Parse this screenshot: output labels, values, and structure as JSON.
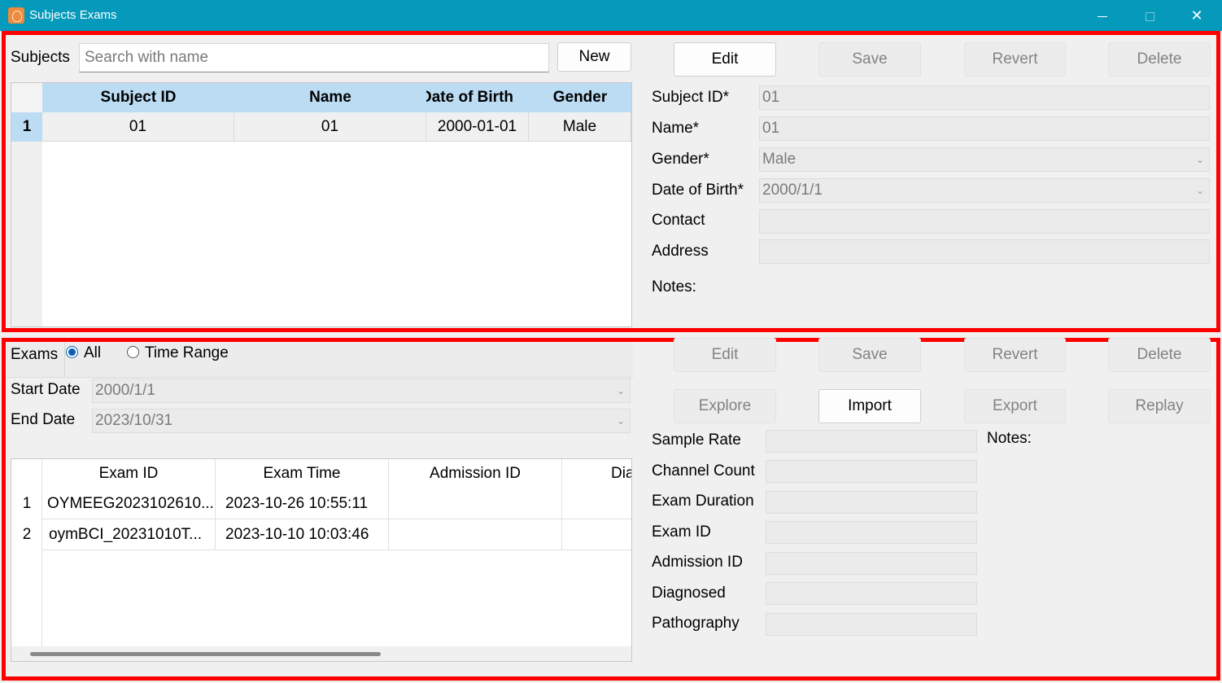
{
  "window": {
    "title": "Subjects Exams",
    "minimize_icon": "minimize-icon",
    "maximize_icon": "maximize-icon",
    "close_glyph": "✕"
  },
  "subjects": {
    "label": "Subjects",
    "search_placeholder": "Search with name",
    "search_value": "",
    "new_label": "New",
    "table": {
      "headers": [
        "Subject ID",
        "Name",
        "Date of Birth",
        "Gender"
      ],
      "rows": [
        {
          "num": "1",
          "cells": [
            "01",
            "01",
            "2000-01-01",
            "Male"
          ]
        }
      ]
    }
  },
  "subject_form": {
    "buttons": {
      "edit": "Edit",
      "save": "Save",
      "revert": "Revert",
      "delete": "Delete"
    },
    "fields": {
      "subject_id": {
        "label": "Subject ID*",
        "value": "01"
      },
      "name": {
        "label": "Name*",
        "value": "01"
      },
      "gender": {
        "label": "Gender*",
        "value": "Male"
      },
      "dob": {
        "label": "Date of Birth*",
        "value": "2000/1/1"
      },
      "contact": {
        "label": "Contact",
        "value": ""
      },
      "address": {
        "label": "Address",
        "value": ""
      },
      "notes": {
        "label": "Notes:",
        "value": ""
      }
    }
  },
  "exams": {
    "label": "Exams",
    "filter_all": "All",
    "filter_range": "Time Range",
    "filter_selected": "All",
    "start_label": "Start Date",
    "start_value": "2000/1/1",
    "end_label": "End Date",
    "end_value": "2023/10/31",
    "table": {
      "headers": [
        "Exam ID",
        "Exam Time",
        "Admission ID",
        "Diagnosed"
      ],
      "rows": [
        {
          "num": "1",
          "cells": [
            "OYMEEG2023102610...",
            "2023-10-26 10:55:11",
            "",
            ""
          ]
        },
        {
          "num": "2",
          "cells": [
            "oymBCI_20231010T...",
            "2023-10-10 10:03:46",
            "",
            ""
          ]
        }
      ]
    }
  },
  "exam_form": {
    "buttons": {
      "edit": "Edit",
      "save": "Save",
      "revert": "Revert",
      "delete": "Delete",
      "explore": "Explore",
      "import": "Import",
      "export": "Export",
      "replay": "Replay"
    },
    "fields": {
      "sample_rate": {
        "label": "Sample Rate",
        "value": ""
      },
      "channel_count": {
        "label": "Channel Count",
        "value": ""
      },
      "exam_duration": {
        "label": "Exam Duration",
        "value": ""
      },
      "exam_id": {
        "label": "Exam ID",
        "value": ""
      },
      "admission_id": {
        "label": "Admission ID",
        "value": ""
      },
      "diagnosed": {
        "label": "Diagnosed",
        "value": ""
      },
      "pathography": {
        "label": "Pathography",
        "value": ""
      }
    },
    "notes_label": "Notes:"
  },
  "colors": {
    "titlebar": "#0599bb",
    "highlight_frame": "#ff0000",
    "header_selected": "#bcdcf4",
    "radio_accent": "#0a5fb4"
  }
}
